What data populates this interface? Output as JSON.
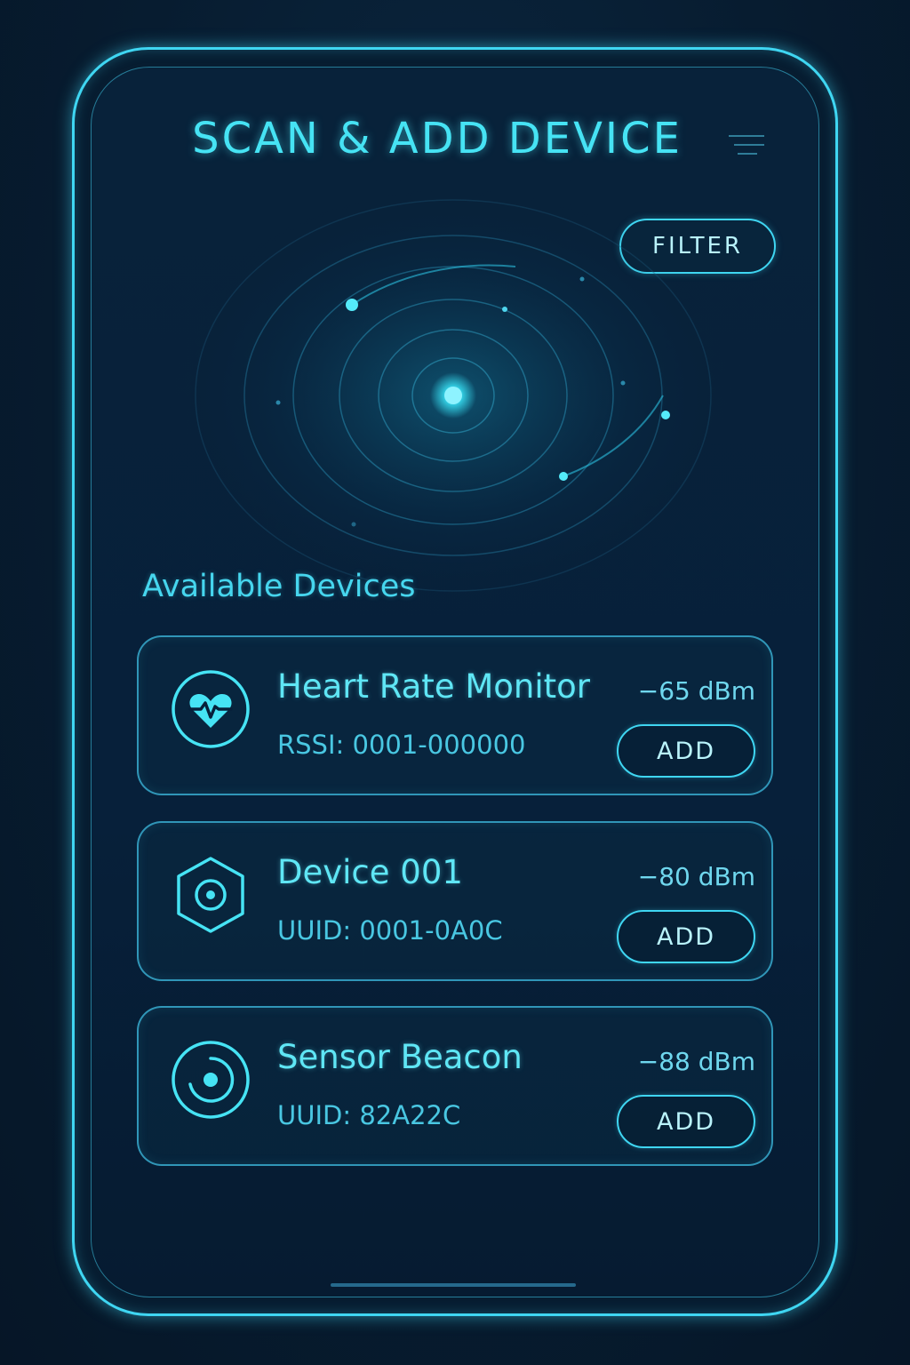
{
  "header": {
    "title": "SCAN & ADD DEVICE",
    "menu_icon": "menu-icon"
  },
  "filter": {
    "label": "FILTER"
  },
  "radar": {
    "icon": "radar-scan"
  },
  "section": {
    "label": "Available Devices"
  },
  "devices": [
    {
      "name": "Heart Rate Monitor",
      "id": "RSSI: 0001-000000",
      "signal": "−65 dBm",
      "add_label": "ADD",
      "icon": "heart-rate-icon"
    },
    {
      "name": "Device 001",
      "id": "UUID: 0001-0A0C",
      "signal": "−80 dBm",
      "add_label": "ADD",
      "icon": "hexagon-device-icon"
    },
    {
      "name": "Sensor Beacon",
      "id": "UUID: 82A22C",
      "signal": "−88 dBm",
      "add_label": "ADD",
      "icon": "beacon-icon"
    }
  ],
  "colors": {
    "accent": "#3fd6f2",
    "background": "#071d31",
    "text": "#5fe6f5"
  }
}
